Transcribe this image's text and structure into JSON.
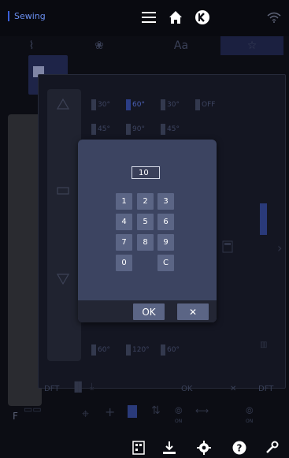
{
  "app_title": "Sewing",
  "top_icons": [
    "menu-icon",
    "home-icon",
    "back-icon",
    "wifi-icon"
  ],
  "tabs": [
    {
      "name": "tab-stitches",
      "icon": "stitch-icon"
    },
    {
      "name": "tab-patterns",
      "icon": "pattern-icon"
    },
    {
      "name": "tab-fonts",
      "label": "Aa"
    },
    {
      "name": "tab-favorites",
      "icon": "star-icon",
      "active": true
    }
  ],
  "angle_buttons_top": [
    "30°",
    "60°",
    "30°",
    "OFF"
  ],
  "angle_buttons_mid": [
    "45°",
    "90°",
    "45°"
  ],
  "angle_buttons_bottom": [
    "60°",
    "120°",
    "60°"
  ],
  "dialog": {
    "value": "10",
    "keys": [
      "1",
      "2",
      "3",
      "4",
      "5",
      "6",
      "7",
      "8",
      "9",
      "0",
      "C"
    ],
    "ok_label": "OK",
    "close_label": "✕"
  },
  "background_labels": {
    "dft_left": "DFT",
    "dft_right": "DFT",
    "ok": "OK",
    "close": "✕",
    "f": "F",
    "on1": "ON",
    "on2": "ON"
  },
  "bottom_icons": [
    "stitch-chart-icon",
    "download-icon",
    "settings-icon",
    "help-icon",
    "tools-icon"
  ]
}
